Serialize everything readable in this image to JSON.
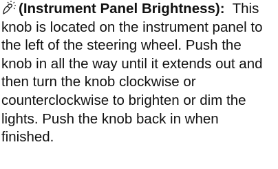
{
  "paragraph": {
    "icon": "brightness-knob-icon",
    "heading": "(Instrument Panel Brightness):",
    "body": "This knob is located on the instrument panel to the left of the steering wheel. Push the knob in all the way until it extends out and then turn the knob clockwise or counterclockwise to brighten or dim the lights. Push the knob back in when finished."
  }
}
